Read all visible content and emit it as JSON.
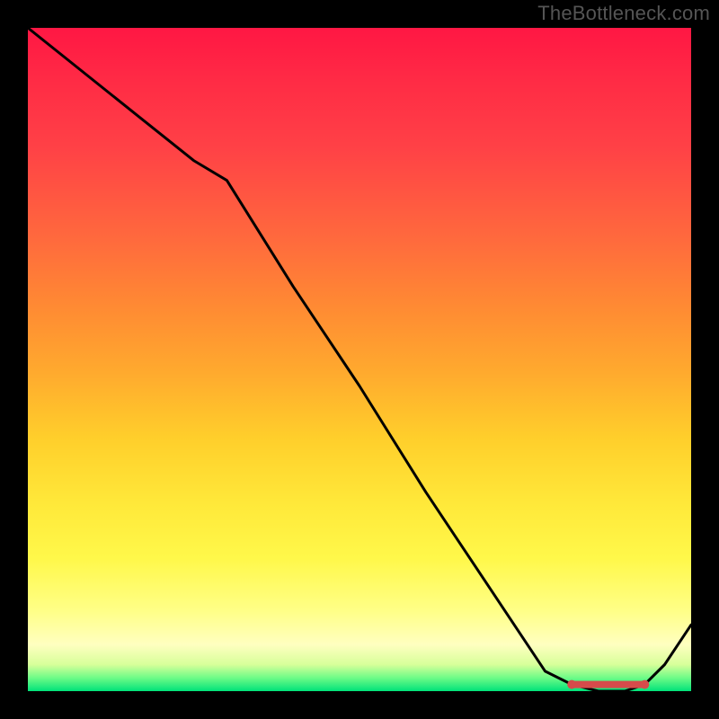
{
  "attribution": "TheBottleneck.com",
  "chart_data": {
    "type": "line",
    "title": "",
    "xlabel": "",
    "ylabel": "",
    "xlim": [
      0,
      100
    ],
    "ylim": [
      0,
      100
    ],
    "grid": false,
    "legend": false,
    "series": [
      {
        "name": "curve",
        "x": [
          0,
          5,
          15,
          25,
          30,
          40,
          50,
          60,
          70,
          78,
          82,
          86,
          90,
          93,
          96,
          100
        ],
        "y": [
          100,
          96,
          88,
          80,
          77,
          61,
          46,
          30,
          15,
          3,
          1,
          0,
          0,
          1,
          4,
          10
        ]
      }
    ],
    "markers": {
      "type": "band",
      "x_start": 82,
      "x_end": 93,
      "y": 1
    }
  },
  "colors": {
    "background": "#000000",
    "curve": "#000000",
    "marker": "#d64b4b",
    "attribution": "#555555"
  }
}
